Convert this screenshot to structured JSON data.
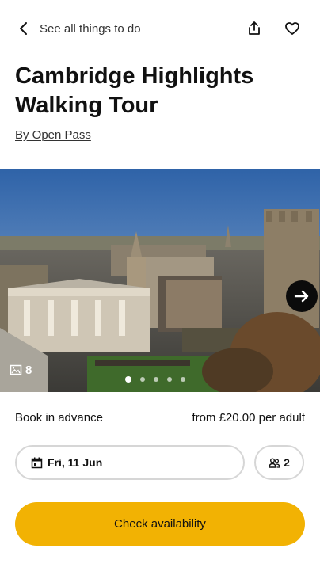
{
  "header": {
    "back_label": "See all things to do",
    "icons": [
      "chevron-left-icon",
      "share-icon",
      "heart-icon"
    ]
  },
  "product": {
    "title": "Cambridge Highlights Walking Tour",
    "byline": "By Open Pass"
  },
  "gallery": {
    "photo_count": "8",
    "dot_count": 5,
    "active_dot": 0,
    "icons": [
      "image-icon",
      "arrow-right-icon"
    ]
  },
  "booking": {
    "book_label": "Book in advance",
    "price_label": "from £20.00 per adult",
    "date_value": "Fri, 11 Jun",
    "guests_value": "2",
    "cta_label": "Check availability"
  },
  "colors": {
    "accent": "#f2b203",
    "text": "#111111",
    "pill_border": "#d6d6d6"
  }
}
